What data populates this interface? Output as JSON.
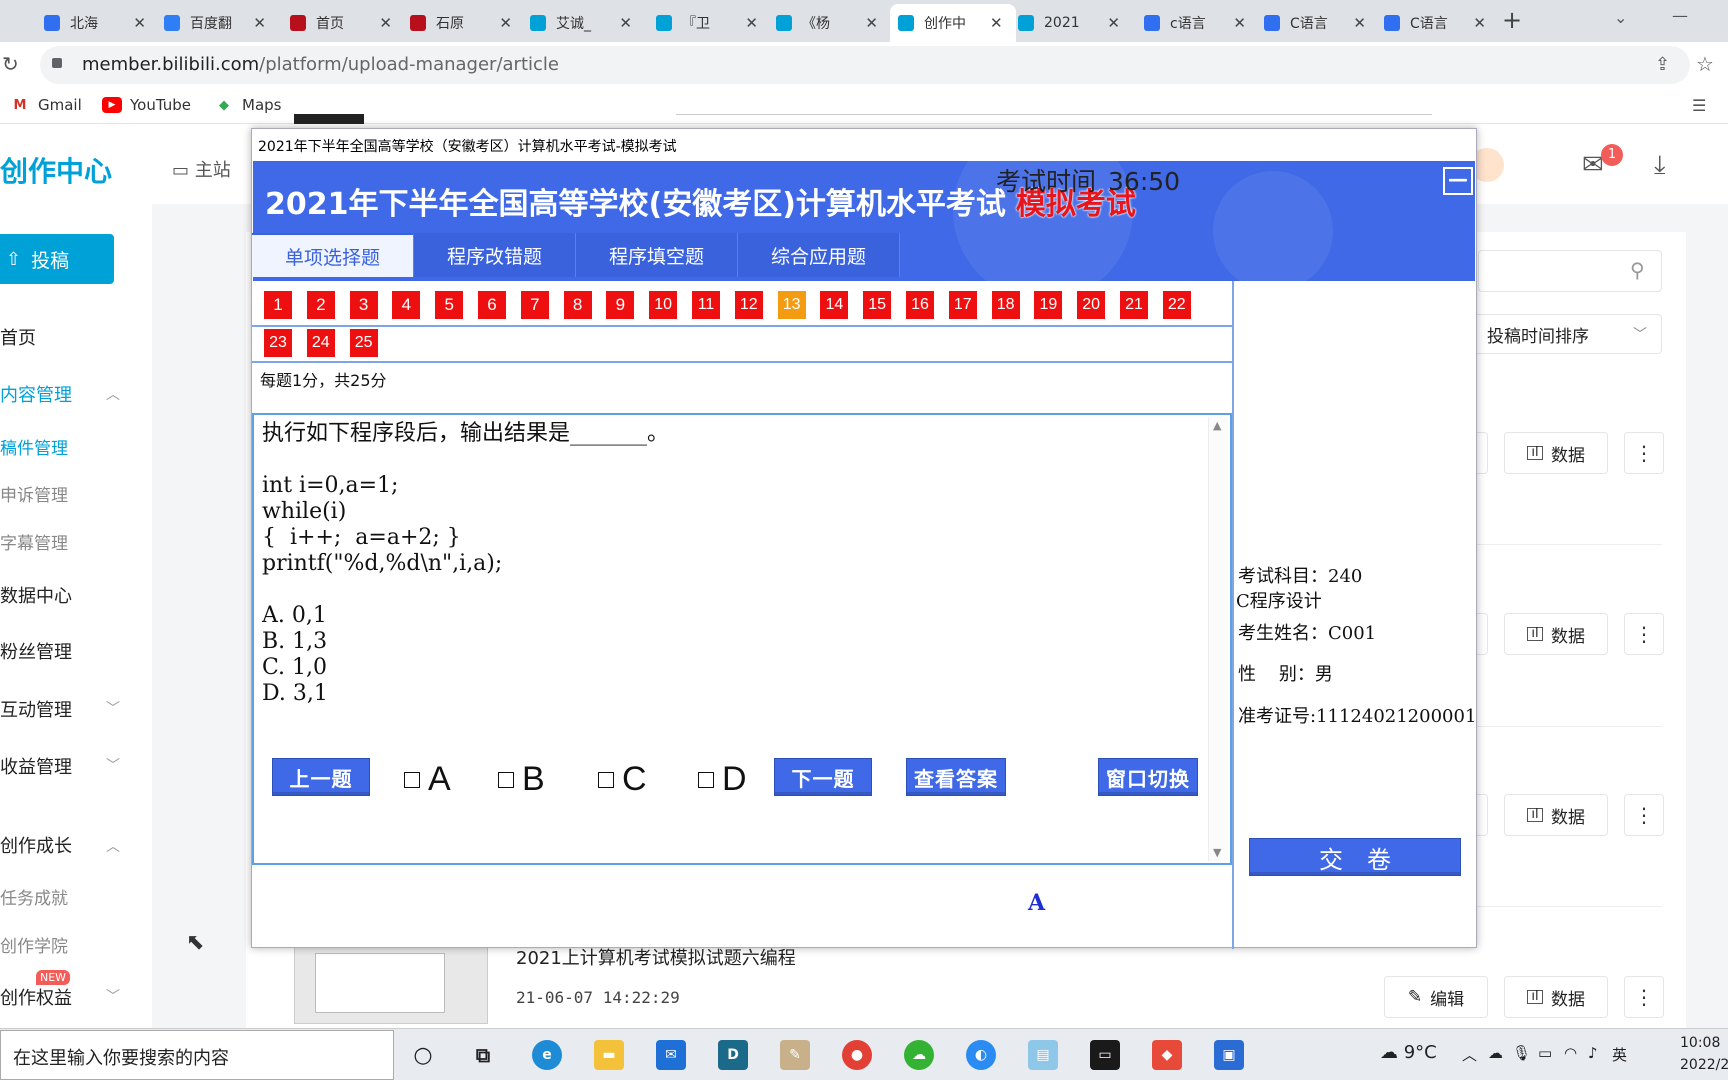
{
  "browser": {
    "tabs": [
      {
        "label": "北海",
        "color": "#2f6ff0",
        "icon": "baidu-paw-icon"
      },
      {
        "label": "百度翻",
        "color": "#2f7ef5",
        "icon": "translate-icon"
      },
      {
        "label": "首页",
        "color": "#b80f1c",
        "icon": "ustc-logo-icon"
      },
      {
        "label": "石原",
        "color": "#b80f1c",
        "icon": "ustc-logo-icon"
      },
      {
        "label": "艾诚_",
        "color": "#00a1d6",
        "icon": "bilibili-tv-icon"
      },
      {
        "label": "『卫",
        "color": "#00a1d6",
        "icon": "bilibili-tv-icon"
      },
      {
        "label": "《杨",
        "color": "#00a1d6",
        "icon": "bilibili-tv-icon"
      },
      {
        "label": "创作中",
        "color": "#00a1d6",
        "icon": "bilibili-tv-icon",
        "active": true
      },
      {
        "label": "2021",
        "color": "#00a1d6",
        "icon": "bilibili-tv-icon"
      },
      {
        "label": "c语言",
        "color": "#2f6ff0",
        "icon": "baidu-paw-icon"
      },
      {
        "label": "C语言",
        "color": "#2f6ff0",
        "icon": "baidu-paw-icon"
      },
      {
        "label": "C语言",
        "color": "#2f6ff0",
        "icon": "baidu-paw-icon"
      }
    ],
    "url_host": "member.bilibili.com",
    "url_path": "/platform/upload-manager/article",
    "bookmarks": [
      {
        "label": "Gmail",
        "color": "#d93025"
      },
      {
        "label": "YouTube",
        "color": "#ff0000"
      },
      {
        "label": "Maps",
        "color": "#34a853"
      }
    ]
  },
  "bili": {
    "logo": "创作中心",
    "main_site": "主站",
    "mail_badge": "1",
    "upload_label": "投稿",
    "sidebar": [
      {
        "label": "首页",
        "type": "top"
      },
      {
        "label": "内容管理",
        "type": "top",
        "selected": true
      },
      {
        "label": "稿件管理",
        "type": "sub",
        "selected": true
      },
      {
        "label": "申诉管理",
        "type": "sub"
      },
      {
        "label": "字幕管理",
        "type": "sub"
      },
      {
        "label": "数据中心",
        "type": "top"
      },
      {
        "label": "粉丝管理",
        "type": "top"
      },
      {
        "label": "互动管理",
        "type": "top"
      },
      {
        "label": "收益管理",
        "type": "top"
      },
      {
        "label": "创作成长",
        "type": "top"
      },
      {
        "label": "任务成就",
        "type": "sub"
      },
      {
        "label": "创作学院",
        "type": "sub"
      },
      {
        "label": "创作权益",
        "type": "top"
      }
    ],
    "new_badge": "NEW",
    "sort_label": "投稿时间排序",
    "data_label": "数据",
    "edit_label": "编辑",
    "video_title": "2021上计算机考试模拟试题六编程",
    "video_date": "21-06-07 14:22:29"
  },
  "exam": {
    "window_title": "2021年下半年全国高等学校（安徽考区）计算机水平考试-模拟考试",
    "heading": "2021年下半年全国高等学校(安徽考区)计算机水平考试",
    "heading_mock": "模拟考试",
    "tabs": [
      "单项选择题",
      "程序改错题",
      "程序填空题",
      "综合应用题"
    ],
    "active_tab": 0,
    "question_numbers": [
      "1",
      "2",
      "3",
      "4",
      "5",
      "6",
      "7",
      "8",
      "9",
      "10",
      "11",
      "12",
      "13",
      "14",
      "15",
      "16",
      "17",
      "18",
      "19",
      "20",
      "21",
      "22",
      "23",
      "24",
      "25"
    ],
    "current_question": "13",
    "score_note": "每题1分，共25分",
    "question_text": "执行如下程序段后，输出结果是_______。\n\nint i=0,a=1;\nwhile(i)\n{  i++;  a=a+2; }\nprintf(\"%d,%d\\n\",i,a);\n\nA. 0,1\nB. 1,3\nC. 1,0\nD. 3,1",
    "prev_label": "上一题",
    "next_label": "下一题",
    "show_answer_label": "查看答案",
    "answer_shown": "A",
    "switch_label": "窗口切换",
    "options": [
      "A",
      "B",
      "C",
      "D"
    ],
    "timer_label": "考试时间",
    "timer_value": "36:50",
    "subject_label": "考试科目：240",
    "subject_name": "C程序设计",
    "candidate_label": "考生姓名：C001",
    "gender_label": "性    别：男",
    "ticket_label": "准考证号:11124021200001",
    "submit_label": "交卷"
  },
  "taskbar": {
    "search_placeholder": "在这里输入你要搜索的内容",
    "temperature": "9°C",
    "ime": "英",
    "time": "10:08",
    "date": "2022/2"
  }
}
